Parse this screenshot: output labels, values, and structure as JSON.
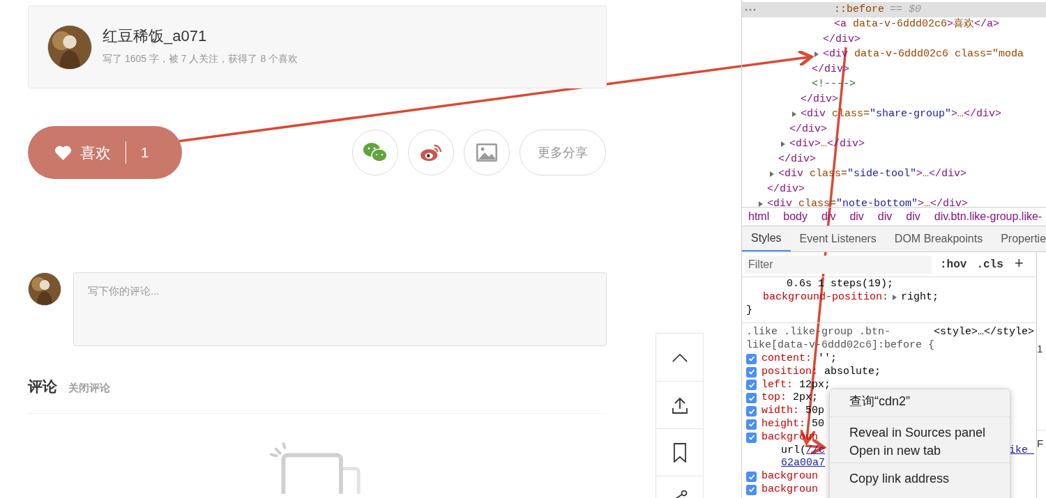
{
  "profile": {
    "name": "红豆稀饭_a071",
    "stats": "写了 1605 字，被 7 人关注，获得了 8 个喜欢"
  },
  "like_button": {
    "label": "喜欢",
    "count": "1"
  },
  "share": {
    "more_label": "更多分享"
  },
  "comment_box": {
    "placeholder": "写下你的评论..."
  },
  "comments": {
    "title": "评论",
    "close_label": "关闭评论"
  },
  "devtools": {
    "dom_tree": [
      {
        "children": [
          {
            "children": [
              {
                "children": [
                  {
                    "children": [
                      {
                        "children": [
                          {
                            "children": [
                              {
                                "text": "::before",
                                "suffix": "== $0",
                                "selected": true,
                                "expandable": false
                              },
                              {
                                "text": "<a data-v-6ddd02c6>喜欢</a>",
                                "selected": false,
                                "expandable": false
                              }
                            ]
                          },
                          {
                            "text": "</div>",
                            "selected": false,
                            "expandable": false
                          },
                          {
                            "text": "<div data-v-6ddd02c6 class=\"moda",
                            "selected": false,
                            "expandable": true
                          }
                        ]
                      },
                      {
                        "text": "</div>",
                        "selected": false,
                        "expandable": false
                      },
                      {
                        "text": "<!---->",
                        "selected": false,
                        "expandable": false
                      }
                    ]
                  },
                  {
                    "text": "</div>",
                    "selected": false,
                    "expandable": false
                  },
                  {
                    "text": "<div class=\"share-group\">…</div>",
                    "selected": false,
                    "expandable": true
                  }
                ]
              },
              {
                "text": "</div>",
                "selected": false,
                "expandable": false
              },
              {
                "text": "<div>…</div>",
                "selected": false,
                "expandable": true
              }
            ]
          },
          {
            "text": "</div>",
            "selected": false,
            "expandable": false
          },
          {
            "text": "<div class=\"side-tool\">…</div>",
            "selected": false,
            "expandable": true
          }
        ]
      },
      {
        "text": "</div>",
        "selected": false,
        "expandable": false
      },
      {
        "text": "<div class=\"note-bottom\">…</div>",
        "selected": false,
        "expandable": true
      }
    ],
    "breadcrumbs": [
      "html",
      "body",
      "div",
      "div",
      "div",
      "div",
      "div.btn.like-group.like-"
    ],
    "tabs": [
      {
        "label": "Styles",
        "selected": true
      },
      {
        "label": "Event Listeners",
        "selected": false
      },
      {
        "label": "DOM Breakpoints",
        "selected": false
      },
      {
        "label": "Propertie",
        "selected": false
      }
    ],
    "filter": {
      "placeholder": "Filter",
      "hov": ":hov",
      "cls": ".cls",
      "add": "+"
    },
    "rule_1": {
      "continuation": "0.6s 1 steps(19);",
      "declarations": [
        {
          "prop": "background-position:",
          "value": "right;",
          "expandable": true
        }
      ],
      "closing": "}"
    },
    "rule_2": {
      "selector_lines": [
        ".like .like-group .btn-",
        "like[data-v-6ddd02c6]:before {"
      ],
      "source": "<style>…</style>",
      "declarations": [
        {
          "kind": "decl",
          "prop": "content:",
          "value": "'';",
          "checked": true
        },
        {
          "kind": "decl",
          "prop": "position:",
          "value": "absolute;",
          "checked": true
        },
        {
          "kind": "decl",
          "prop": "left:",
          "value": "12px;",
          "checked": true
        },
        {
          "kind": "decl",
          "prop": "top:",
          "value": "2px;",
          "checked": true
        },
        {
          "kind": "decl",
          "prop": "width:",
          "value": "50p",
          "checked": true
        },
        {
          "kind": "decl",
          "prop": "height:",
          "value": "50",
          "checked": true
        },
        {
          "kind": "decl",
          "prop": "backgroun",
          "checked": true
        },
        {
          "kind": "url",
          "text": "url(",
          "link": "//c",
          "tail_link": "ike_"
        },
        {
          "kind": "link",
          "link": "62a00a7"
        },
        {
          "kind": "decl",
          "prop": "backgroun",
          "checked": true
        },
        {
          "kind": "decl",
          "prop": "backgroun",
          "checked": true
        }
      ]
    },
    "side_pane": [
      "1",
      "F"
    ],
    "context_menu": [
      [
        "查询“cdn2”"
      ],
      [
        "Reveal in Sources panel",
        "Open in new tab"
      ],
      [
        "Copy link address"
      ]
    ]
  }
}
